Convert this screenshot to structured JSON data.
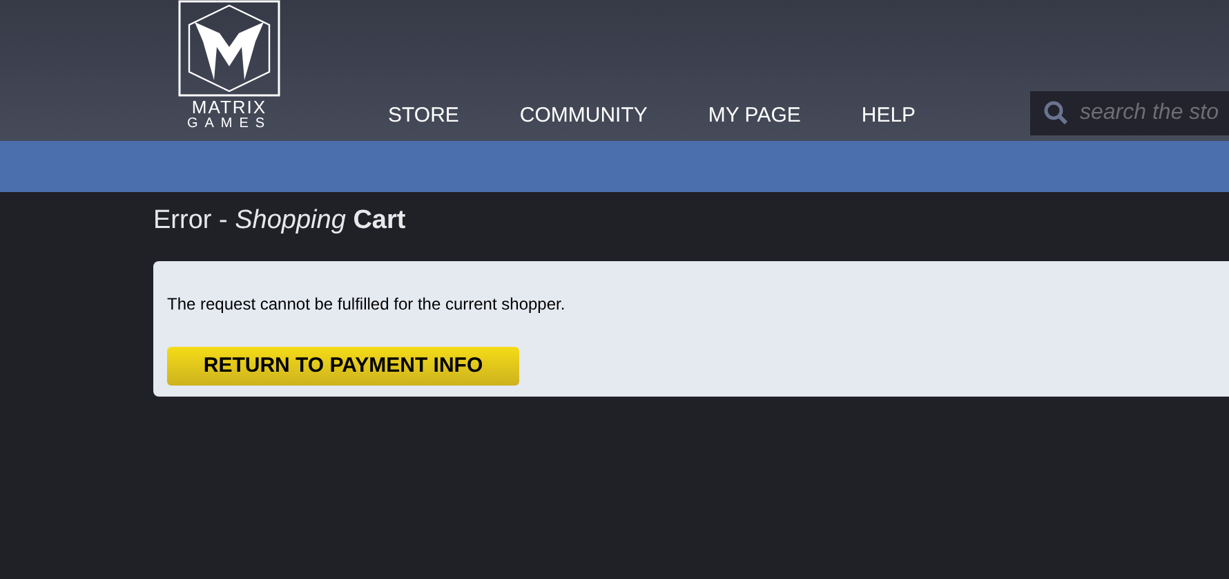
{
  "logo": {
    "line_1": "MATRIX",
    "line_2": "GAMES"
  },
  "nav": [
    {
      "label": "STORE"
    },
    {
      "label": "COMMUNITY"
    },
    {
      "label": "MY PAGE"
    },
    {
      "label": "HELP"
    }
  ],
  "search": {
    "placeholder": "search the sto"
  },
  "page_title": "Error - *Shopping* **Cart**",
  "message": "The request cannot be fulfilled for the current shopper.",
  "button": "RETURN TO PAYMENT INFO"
}
